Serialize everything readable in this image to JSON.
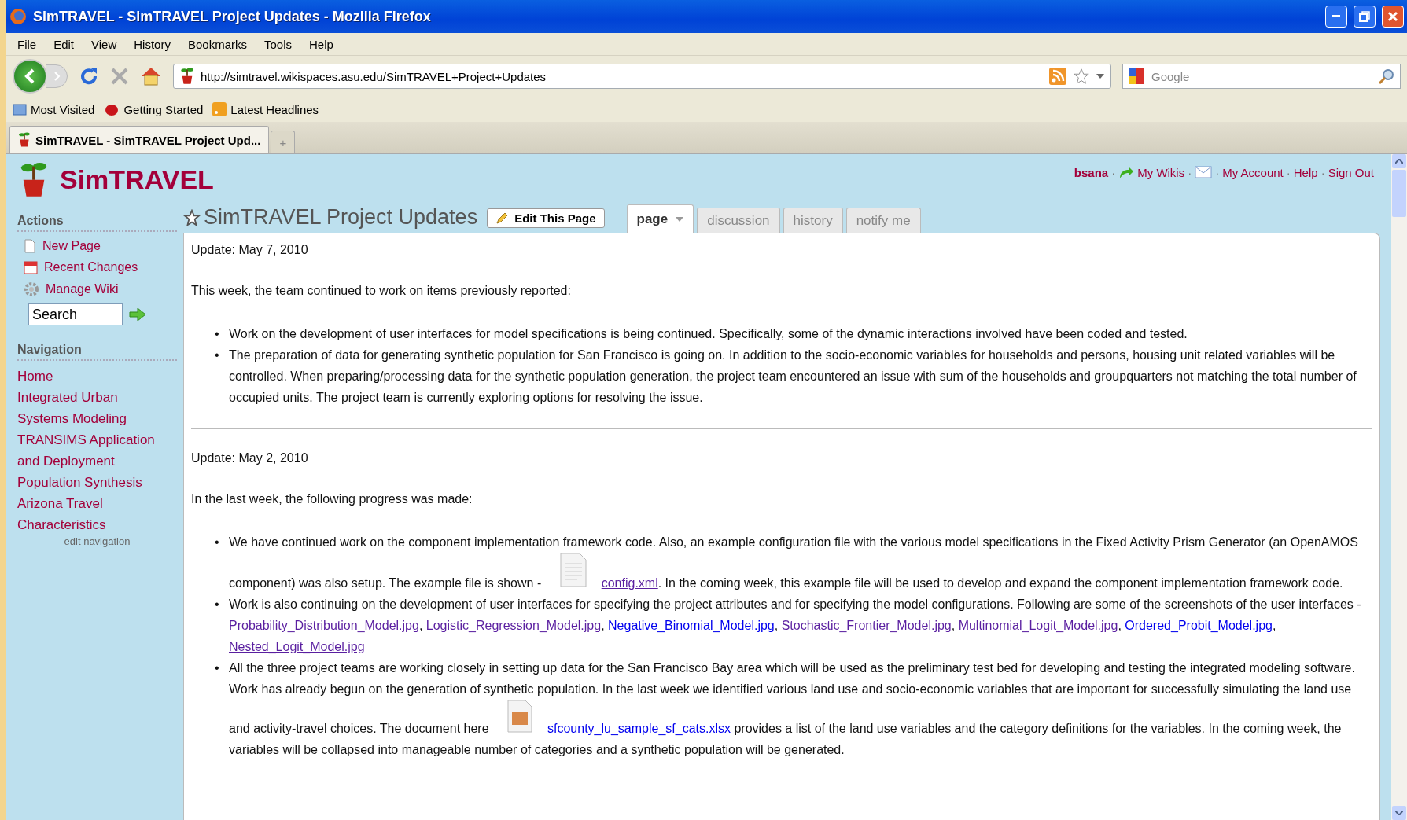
{
  "window": {
    "title": "SimTRAVEL - SimTRAVEL Project Updates - Mozilla Firefox"
  },
  "menu": [
    "File",
    "Edit",
    "View",
    "History",
    "Bookmarks",
    "Tools",
    "Help"
  ],
  "address": {
    "value": "http://simtravel.wikispaces.asu.edu/SimTRAVEL+Project+Updates"
  },
  "search_box": {
    "placeholder": "Google"
  },
  "bookmarks": [
    {
      "label": "Most Visited",
      "kind": "folder"
    },
    {
      "label": "Getting Started",
      "kind": "bug"
    },
    {
      "label": "Latest Headlines",
      "kind": "feed"
    }
  ],
  "browser_tabs": [
    {
      "label": "SimTRAVEL - SimTRAVEL Project Upd...",
      "selected": true
    },
    {
      "label": "+",
      "selected": false
    }
  ],
  "site": {
    "name": "SimTRAVEL"
  },
  "user_bar": {
    "separator": "·",
    "items": [
      {
        "label": "bsana",
        "kind": "user"
      },
      {
        "label": "My Wikis",
        "kind": "wikis"
      },
      {
        "kind": "mail"
      },
      {
        "label": "My Account",
        "kind": "link"
      },
      {
        "label": "Help",
        "kind": "link"
      },
      {
        "label": "Sign Out",
        "kind": "link"
      }
    ]
  },
  "page_title": "SimTRAVEL Project Updates",
  "edit_button": "Edit This Page",
  "page_tabs": [
    {
      "label": "page",
      "selected": true
    },
    {
      "label": "discussion",
      "selected": false
    },
    {
      "label": "history",
      "selected": false
    },
    {
      "label": "notify me",
      "selected": false
    }
  ],
  "sidebar": {
    "actions_heading": "Actions",
    "actions": [
      {
        "label": "New Page",
        "kind": "new"
      },
      {
        "label": "Recent Changes",
        "kind": "calendar"
      },
      {
        "label": "Manage Wiki",
        "kind": "gear"
      }
    ],
    "search": {
      "placeholder": "Search"
    },
    "navigation_heading": "Navigation",
    "navigation": [
      "Home",
      "Integrated Urban Systems Modeling",
      "TRANSIMS Application and Deployment",
      "Population Synthesis",
      "Arizona Travel Characteristics"
    ],
    "edit_navigation": "edit navigation"
  },
  "updates": [
    {
      "bullet": "•",
      "date": "Update: May 7, 2010",
      "intro": "This week, the team continued to work on items previously reported:",
      "bullets": [
        [
          {
            "kind": "text",
            "text": "Work on the development of user interfaces for model specifications is being continued. Specifically, some of the dynamic interactions involved have been coded and tested."
          }
        ],
        [
          {
            "kind": "text",
            "text": "The preparation of data for generating synthetic population for San Francisco is going on. In addition to the socio-economic variables for households and persons, housing unit related variables will be controlled. When preparing/processing data for the synthetic population generation, the project team encountered an issue with sum of the households and groupquarters not matching the total number of occupied units. The project team is currently exploring options for resolving the issue."
          }
        ]
      ]
    },
    {
      "bullet": "•",
      "date": "Update: May 2, 2010",
      "intro": "In the last week, the following progress was made:",
      "bullets": [
        [
          {
            "kind": "text",
            "text": "We have continued work on the component implementation framework code. Also, an example configuration file with the various model specifications in the Fixed Activity Prism Generator (an OpenAMOS component) was also setup. The example file is shown - "
          },
          {
            "kind": "document"
          },
          {
            "kind": "link",
            "text": "config.xml",
            "visited": true
          },
          {
            "kind": "text",
            "text": ". In the coming week, this example file will be used to develop and expand the component implementation framework code."
          }
        ],
        [
          {
            "kind": "text",
            "text": "Work is also continuing on the development of user interfaces for specifying the project attributes and for specifying the model configurations. Following are some of the screenshots of the user interfaces - "
          },
          {
            "kind": "link",
            "text": "Probability_Distribution_Model.jpg",
            "visited": true
          },
          {
            "kind": "text",
            "text": ", "
          },
          {
            "kind": "link",
            "text": "Logistic_Regression_Model.jpg",
            "visited": true
          },
          {
            "kind": "text",
            "text": ", "
          },
          {
            "kind": "link",
            "text": "Negative_Binomial_Model.jpg",
            "visited": false
          },
          {
            "kind": "text",
            "text": ", "
          },
          {
            "kind": "link",
            "text": "Stochastic_Frontier_Model.jpg",
            "visited": true
          },
          {
            "kind": "text",
            "text": ", "
          },
          {
            "kind": "link",
            "text": "Multinomial_Logit_Model.jpg",
            "visited": true
          },
          {
            "kind": "text",
            "text": ", "
          },
          {
            "kind": "link",
            "text": "Ordered_Probit_Model.jpg",
            "visited": false
          },
          {
            "kind": "text",
            "text": ", "
          },
          {
            "kind": "link",
            "text": "Nested_Logit_Model.jpg",
            "visited": true
          }
        ],
        [
          {
            "kind": "text",
            "text": "All the three project teams are working closely in setting up data for the San Francisco Bay area which will be used as the preliminary test bed for developing and testing the integrated modeling software. Work has already begun on the generation of synthetic population. In the last week we identified various land use and socio-economic variables that are important for successfully simulating the land use and activity-travel choices. The document here "
          },
          {
            "kind": "package"
          },
          {
            "kind": "link",
            "text": "sfcounty_lu_sample_sf_cats.xlsx",
            "visited": false
          },
          {
            "kind": "text",
            "text": " provides a list of the land use variables and the category definitions for the variables. In the coming week, the variables will be collapsed into manageable number of categories and a synthetic population will be generated."
          }
        ]
      ]
    }
  ]
}
